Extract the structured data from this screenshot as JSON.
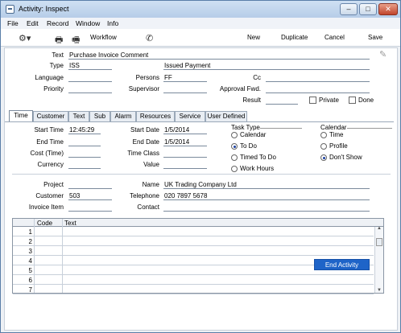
{
  "window": {
    "title": "Activity: Inspect"
  },
  "menu": [
    "File",
    "Edit",
    "Record",
    "Window",
    "Info"
  ],
  "toolbar": {
    "workflow": "Workflow",
    "new": "New",
    "duplicate": "Duplicate",
    "cancel": "Cancel",
    "save": "Save"
  },
  "header": {
    "text_label": "Text",
    "text_value": "Purchase Invoice Comment",
    "type_label": "Type",
    "type_value": "ISS",
    "type_desc": "Issued Payment",
    "language_label": "Language",
    "persons_label": "Persons",
    "persons_value": "FF",
    "cc_label": "Cc",
    "priority_label": "Priority",
    "supervisor_label": "Supervisor",
    "approval_label": "Approval Fwd.",
    "result_label": "Result",
    "private_label": "Private",
    "done_label": "Done"
  },
  "tabs": [
    "Time",
    "Customer",
    "Text",
    "Sub",
    "Alarm",
    "Resources",
    "Service",
    "User Defined"
  ],
  "time": {
    "start_time_label": "Start Time",
    "start_time": "12:45:29",
    "end_time_label": "End Time",
    "cost_label": "Cost (Time)",
    "currency_label": "Currency",
    "start_date_label": "Start Date",
    "start_date": "1/5/2014",
    "end_date_label": "End Date",
    "end_date": "1/5/2014",
    "time_class_label": "Time Class",
    "value_label": "Value",
    "task_type_label": "Task Type",
    "task_types": [
      "Calendar",
      "To Do",
      "Timed To Do",
      "Work Hours"
    ],
    "task_selected": 1,
    "calendar_label": "Calendar",
    "calendar_opts": [
      "Time",
      "Profile",
      "Don't Show"
    ],
    "calendar_selected": 2
  },
  "lower": {
    "project_label": "Project",
    "customer_label": "Customer",
    "customer_value": "503",
    "invoice_label": "Invoice Item",
    "name_label": "Name",
    "name_value": "UK Trading Company Ltd",
    "telephone_label": "Telephone",
    "telephone_value": "020 7897 5678",
    "contact_label": "Contact"
  },
  "grid": {
    "col_code": "Code",
    "col_text": "Text",
    "rows": [
      "1",
      "2",
      "3",
      "4",
      "5",
      "6",
      "7"
    ]
  },
  "end_activity": "End Activity"
}
